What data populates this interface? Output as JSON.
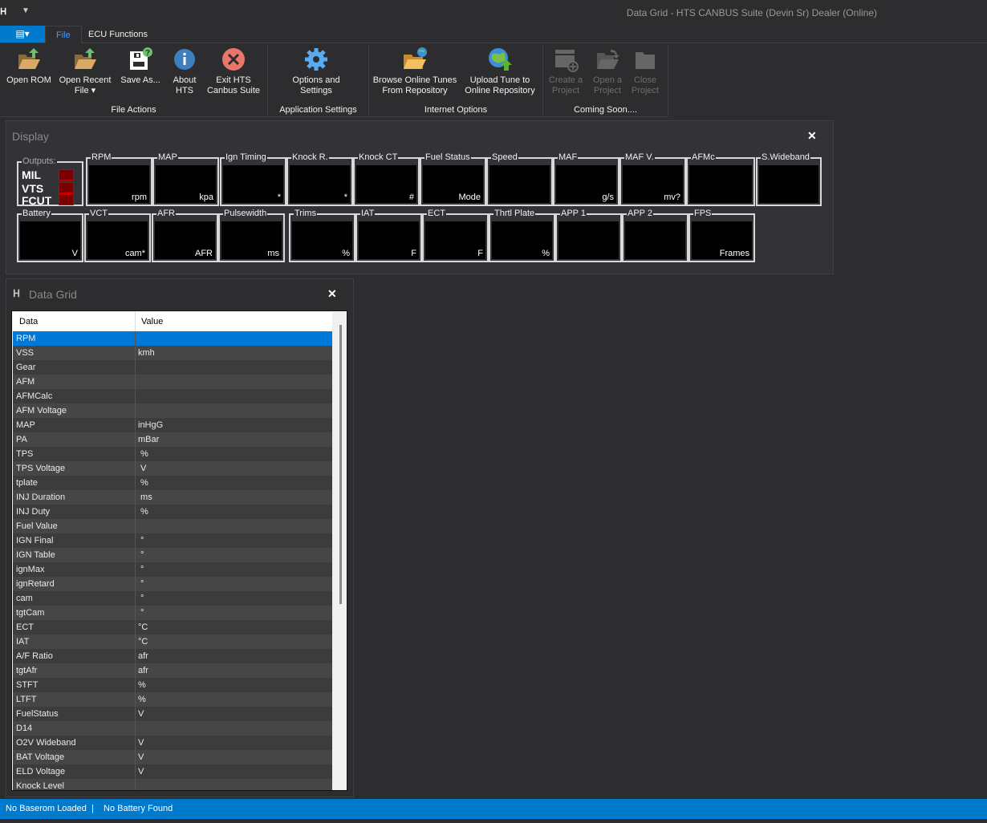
{
  "window": {
    "title": "Data Grid - HTS CANBUS Suite (Devin Sr) Dealer (Online)",
    "logo": "HTS"
  },
  "tabs": {
    "app_menu_icon": "list-icon",
    "file": "File",
    "ecu": "ECU Functions"
  },
  "ribbon": {
    "buttons": [
      {
        "label": "Open ROM",
        "icon": "open-folder-icon"
      },
      {
        "label": "Open Recent File ▾",
        "icon": "open-folder-icon"
      },
      {
        "label": "Save As...",
        "icon": "save-icon"
      },
      {
        "label": "About HTS",
        "icon": "info-icon"
      },
      {
        "label": "Exit HTS Canbus Suite",
        "icon": "close-circle-icon"
      },
      {
        "label": "Options and Settings",
        "icon": "gear-icon"
      },
      {
        "label": "Browse Online Tunes From Repository",
        "icon": "web-folder-icon"
      },
      {
        "label": "Upload Tune to Online Repository",
        "icon": "globe-upload-icon"
      },
      {
        "label": "Create a Project",
        "icon": "new-project-icon",
        "disabled": true
      },
      {
        "label": "Open a Project",
        "icon": "open-project-icon",
        "disabled": true
      },
      {
        "label": "Close Project",
        "icon": "folder-icon",
        "disabled": true
      }
    ],
    "groups": [
      "File Actions",
      "Application Settings",
      "Internet Options",
      "Coming Soon...."
    ]
  },
  "display": {
    "title": "Display",
    "outputs": {
      "label": "Outputs:",
      "items": [
        "MIL",
        "VTS",
        "FCUT"
      ],
      "led_color": "#7a0000"
    },
    "row1": [
      {
        "label": "RPM",
        "unit": "rpm"
      },
      {
        "label": "MAP",
        "unit": "kpa"
      },
      {
        "label": "Ign Timing",
        "unit": "*"
      },
      {
        "label": "Knock R.",
        "unit": "*"
      },
      {
        "label": "Knock CT",
        "unit": "#"
      },
      {
        "label": "Fuel Status",
        "unit": "Mode"
      },
      {
        "label": "Speed",
        "unit": ""
      },
      {
        "label": "MAF",
        "unit": "g/s"
      },
      {
        "label": "MAF V.",
        "unit": "mv?"
      },
      {
        "label": "AFMc",
        "unit": ""
      },
      {
        "label": "S.Wideband",
        "unit": ""
      }
    ],
    "row2": [
      {
        "label": "Battery",
        "unit": "V"
      },
      {
        "label": "VCT",
        "unit": "cam*"
      },
      {
        "label": "AFR",
        "unit": "AFR"
      },
      {
        "label": "Pulsewidth",
        "unit": "ms"
      },
      {
        "label": "Trims",
        "unit": "%"
      },
      {
        "label": "IAT",
        "unit": "F"
      },
      {
        "label": "ECT",
        "unit": "F"
      },
      {
        "label": "Thrtl Plate",
        "unit": "%"
      },
      {
        "label": "APP 1",
        "unit": ""
      },
      {
        "label": "APP 2",
        "unit": ""
      },
      {
        "label": "FPS",
        "unit": "Frames"
      }
    ]
  },
  "datagrid": {
    "title": "Data Grid",
    "columns": [
      "Data",
      "Value"
    ],
    "selected_color": "#0078d7",
    "rows": [
      [
        "RPM",
        ""
      ],
      [
        "VSS",
        "kmh"
      ],
      [
        "Gear",
        ""
      ],
      [
        "AFM",
        ""
      ],
      [
        "AFMCalc",
        ""
      ],
      [
        "AFM Voltage",
        ""
      ],
      [
        "MAP",
        "inHgG"
      ],
      [
        "PA",
        "mBar"
      ],
      [
        "TPS",
        " %"
      ],
      [
        "TPS Voltage",
        " V"
      ],
      [
        "tplate",
        " %"
      ],
      [
        "INJ Duration",
        " ms"
      ],
      [
        "INJ Duty",
        " %"
      ],
      [
        "Fuel Value",
        ""
      ],
      [
        "IGN Final",
        " °"
      ],
      [
        "IGN Table",
        " °"
      ],
      [
        "ignMax",
        " °"
      ],
      [
        "ignRetard",
        " °"
      ],
      [
        "cam",
        " °"
      ],
      [
        "tgtCam",
        " °"
      ],
      [
        "ECT",
        "°C"
      ],
      [
        "IAT",
        "°C"
      ],
      [
        "A/F Ratio",
        "afr"
      ],
      [
        "tgtAfr",
        "afr"
      ],
      [
        "STFT",
        "%"
      ],
      [
        "LTFT",
        "%"
      ],
      [
        "FuelStatus",
        "V"
      ],
      [
        "D14",
        ""
      ],
      [
        "O2V Wideband",
        "V"
      ],
      [
        "BAT Voltage",
        "V"
      ],
      [
        "ELD Voltage",
        "V"
      ],
      [
        "Knock Level",
        ""
      ]
    ]
  },
  "status": {
    "rom": "No Baserom Loaded",
    "sep": "|",
    "battery": "No Battery Found"
  }
}
